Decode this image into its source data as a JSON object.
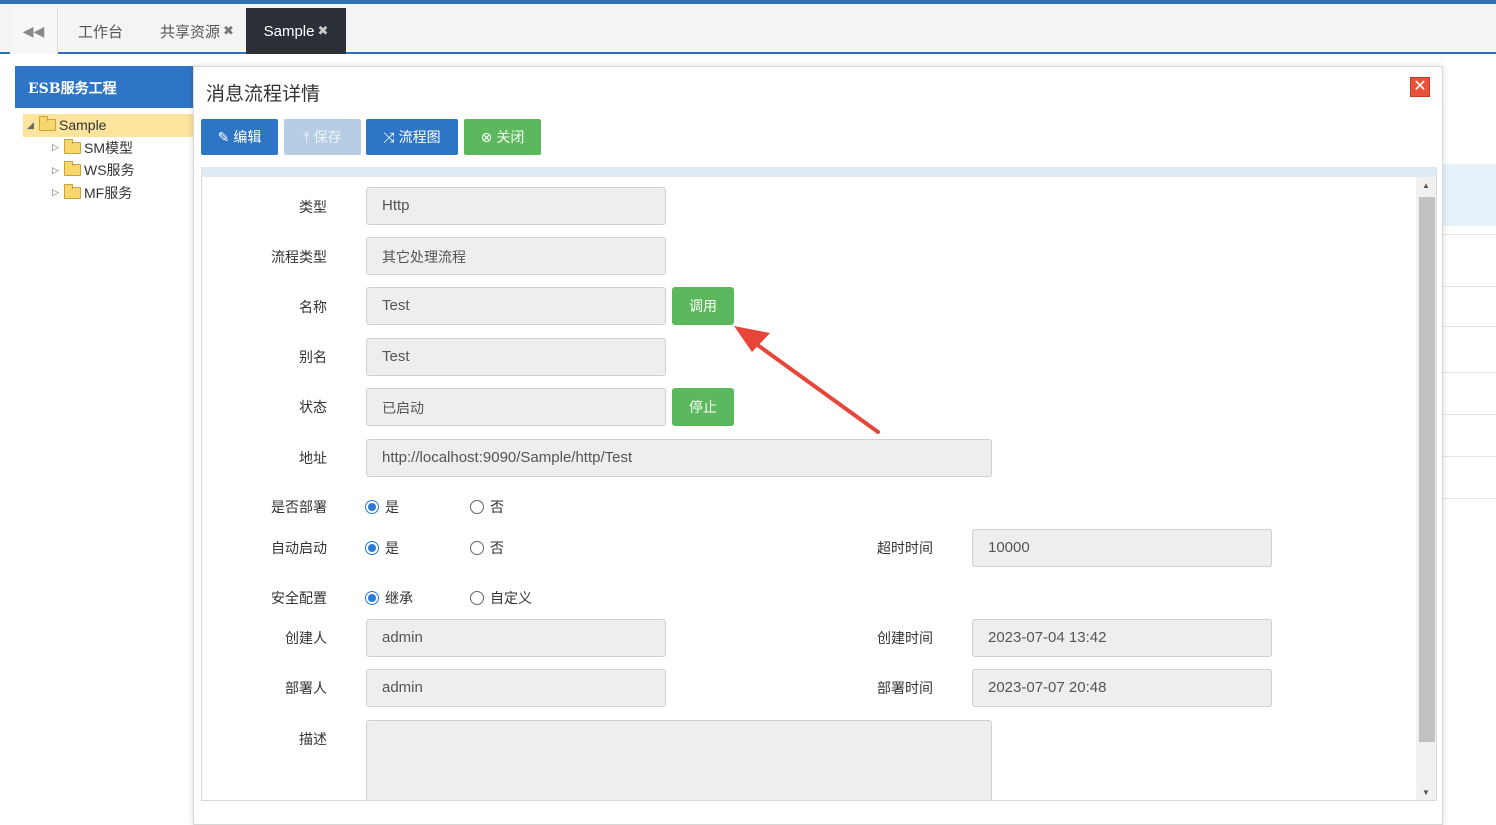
{
  "tabs": {
    "workbench": "工作台",
    "shared": "共享资源",
    "sample": "Sample",
    "close_glyph": "✖"
  },
  "left_panel": {
    "title": "ESB服务工程",
    "tree": {
      "root": "Sample",
      "children": [
        "SM模型",
        "WS服务",
        "MF服务"
      ]
    }
  },
  "dialog": {
    "title": "消息流程详情",
    "close_glyph": "✕",
    "toolbar": {
      "edit": "编辑",
      "save": "保存",
      "flow": "流程图",
      "close": "关闭"
    }
  },
  "form": {
    "type": {
      "label": "类型",
      "value": "Http"
    },
    "flow_type": {
      "label": "流程类型",
      "value": "其它处理流程"
    },
    "name": {
      "label": "名称",
      "value": "Test",
      "button": "调用"
    },
    "alias": {
      "label": "别名",
      "value": "Test"
    },
    "status": {
      "label": "状态",
      "value": "已启动",
      "button": "停止"
    },
    "address": {
      "label": "地址",
      "value": "http://localhost:9090/Sample/http/Test"
    },
    "deployed": {
      "label": "是否部署",
      "options": [
        "是",
        "否"
      ],
      "selected": "是"
    },
    "autostart": {
      "label": "自动启动",
      "options": [
        "是",
        "否"
      ],
      "selected": "是"
    },
    "timeout": {
      "label": "超时时间",
      "value": "10000"
    },
    "security": {
      "label": "安全配置",
      "options": [
        "继承",
        "自定义"
      ],
      "selected": "继承"
    },
    "creator": {
      "label": "创建人",
      "value": "admin"
    },
    "created_time": {
      "label": "创建时间",
      "value": "2023-07-04 13:42"
    },
    "deployer": {
      "label": "部署人",
      "value": "admin"
    },
    "deployed_time": {
      "label": "部署时间",
      "value": "2023-07-07 20:48"
    },
    "description": {
      "label": "描述",
      "value": ""
    }
  },
  "colors": {
    "accent_blue": "#2f75c6",
    "success_green": "#5cb85c",
    "annotation_red": "#e8453a"
  }
}
